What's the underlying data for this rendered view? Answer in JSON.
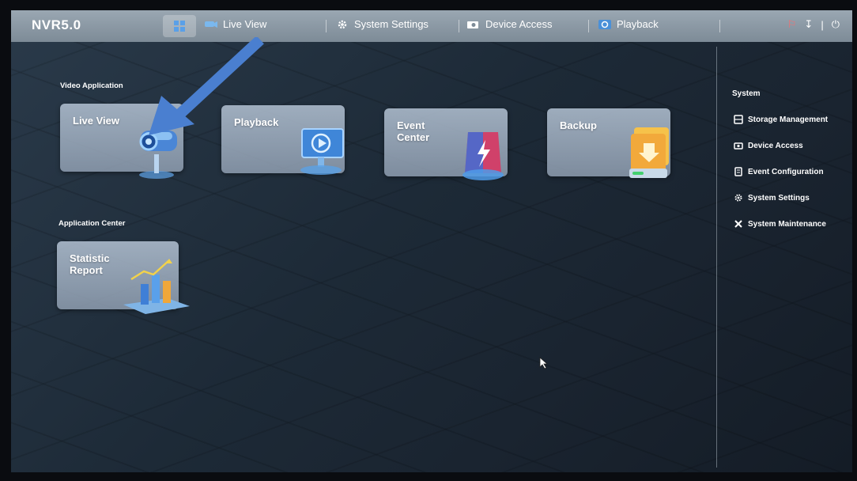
{
  "brand": "NVR5.0",
  "topbar": {
    "tabs": [
      {
        "label": "Live View",
        "icon": "camera-icon"
      },
      {
        "label": "System Settings",
        "icon": "gear-icon"
      },
      {
        "label": "Device Access",
        "icon": "device-icon"
      },
      {
        "label": "Playback",
        "icon": "playback-icon"
      }
    ]
  },
  "sections": {
    "video_application": "Video Application",
    "application_center": "Application Center"
  },
  "tiles": [
    {
      "label": "Live View"
    },
    {
      "label": "Playback"
    },
    {
      "label": "Event\nCenter"
    },
    {
      "label": "Backup"
    },
    {
      "label": "Statistic\nReport"
    }
  ],
  "system_panel": {
    "title": "System",
    "items": [
      {
        "label": "Storage Management",
        "icon": "storage-icon"
      },
      {
        "label": "Device Access",
        "icon": "device-access-icon"
      },
      {
        "label": "Event Configuration",
        "icon": "event-config-icon"
      },
      {
        "label": "System Settings",
        "icon": "gear-icon"
      },
      {
        "label": "System Maintenance",
        "icon": "tools-icon"
      }
    ]
  },
  "colors": {
    "accent_blue": "#4a7fd0",
    "topbar": "#8a97a3"
  }
}
